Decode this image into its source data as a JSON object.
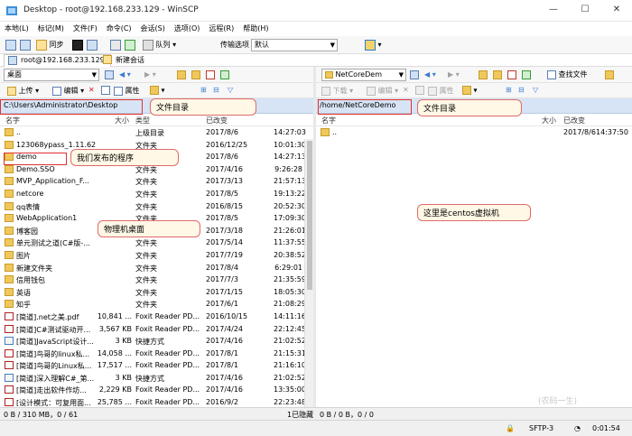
{
  "window": {
    "title": "Desktop - root@192.168.233.129 - WinSCP",
    "minimize": "—",
    "maximize": "☐",
    "close": "✕"
  },
  "menu": [
    "本地(L)",
    "标记(M)",
    "文件(F)",
    "命令(C)",
    "会话(S)",
    "选项(O)",
    "远程(R)",
    "帮助(H)"
  ],
  "toolbar": {
    "sync": "同步",
    "queue": "队列",
    "transfer_label": "传输选项",
    "transfer_value": "默认"
  },
  "session": {
    "tab": "root@192.168.233.129",
    "new": "新建会话"
  },
  "left": {
    "location": "桌面",
    "upload": "上传",
    "edit": "编辑",
    "props": "属性",
    "path": "C:\\Users\\Administrator\\Desktop",
    "columns": {
      "name": "名字",
      "size": "大小",
      "type": "类型",
      "changed": "已改变"
    },
    "files": [
      {
        "name": "..",
        "size": "",
        "type": "上级目录",
        "date": "2017/8/6",
        "time": "14:27:03",
        "icon": "up"
      },
      {
        "name": "123068ypass_1.11.62",
        "size": "",
        "type": "文件夹",
        "date": "2016/12/25",
        "time": "10:01:30",
        "icon": "folder"
      },
      {
        "name": "demo",
        "size": "",
        "type": "文件夹",
        "date": "2017/8/6",
        "time": "14:27:13",
        "icon": "folder"
      },
      {
        "name": "Demo.SSO",
        "size": "",
        "type": "文件夹",
        "date": "2017/4/16",
        "time": "9:26:28",
        "icon": "folder"
      },
      {
        "name": "MVP_Application_F...",
        "size": "",
        "type": "文件夹",
        "date": "2017/3/13",
        "time": "21:57:13",
        "icon": "folder"
      },
      {
        "name": "netcore",
        "size": "",
        "type": "文件夹",
        "date": "2017/8/5",
        "time": "19:13:22",
        "icon": "folder"
      },
      {
        "name": "qq表情",
        "size": "",
        "type": "文件夹",
        "date": "2016/8/15",
        "time": "20:52:30",
        "icon": "folder"
      },
      {
        "name": "WebApplication1",
        "size": "",
        "type": "文件夹",
        "date": "2017/8/5",
        "time": "17:09:30",
        "icon": "folder"
      },
      {
        "name": "博客园",
        "size": "",
        "type": "文件夹",
        "date": "2017/3/18",
        "time": "21:26:01",
        "icon": "folder"
      },
      {
        "name": "单元测试之道(C#版-...",
        "size": "",
        "type": "文件夹",
        "date": "2017/5/14",
        "time": "11:37:55",
        "icon": "folder"
      },
      {
        "name": "图片",
        "size": "",
        "type": "文件夹",
        "date": "2017/7/19",
        "time": "20:38:52",
        "icon": "folder"
      },
      {
        "name": "新建文件夹",
        "size": "",
        "type": "文件夹",
        "date": "2017/8/4",
        "time": "6:29:01",
        "icon": "folder"
      },
      {
        "name": "信用钱包",
        "size": "",
        "type": "文件夹",
        "date": "2017/7/3",
        "time": "21:35:59",
        "icon": "folder"
      },
      {
        "name": "英语",
        "size": "",
        "type": "文件夹",
        "date": "2017/1/15",
        "time": "18:05:30",
        "icon": "folder"
      },
      {
        "name": "知乎",
        "size": "",
        "type": "文件夹",
        "date": "2017/6/1",
        "time": "21:08:29",
        "icon": "folder"
      },
      {
        "name": "[简道].net之美.pdf",
        "size": "10,841 ...",
        "type": "Foxit Reader PD...",
        "date": "2016/10/15",
        "time": "14:11:16",
        "icon": "pdf"
      },
      {
        "name": "[简道]C#测试驱动开...",
        "size": "3,567 KB",
        "type": "Foxit Reader PD...",
        "date": "2017/4/24",
        "time": "22:12:45",
        "icon": "pdf"
      },
      {
        "name": "[简道]JavaScript设计...",
        "size": "3 KB",
        "type": "快捷方式",
        "date": "2017/4/16",
        "time": "21:02:52",
        "icon": "lnk"
      },
      {
        "name": "[简道]鸟哥的linux私...",
        "size": "14,058 ...",
        "type": "Foxit Reader PD...",
        "date": "2017/8/1",
        "time": "21:15:31",
        "icon": "pdf"
      },
      {
        "name": "[简道]鸟哥的Linux私...",
        "size": "17,517 ...",
        "type": "Foxit Reader PD...",
        "date": "2017/8/1",
        "time": "21:16:10",
        "icon": "pdf"
      },
      {
        "name": "[简道]深入理解C#_第...",
        "size": "3 KB",
        "type": "快捷方式",
        "date": "2017/4/16",
        "time": "21:02:52",
        "icon": "lnk"
      },
      {
        "name": "[简道]走出软件作坊...",
        "size": "2,229 KB",
        "type": "Foxit Reader PD...",
        "date": "2017/4/16",
        "time": "13:35:00",
        "icon": "pdf"
      },
      {
        "name": "[设计模式：可复用面...",
        "size": "25,785 ...",
        "type": "Foxit Reader PD...",
        "date": "2016/9/2",
        "time": "22:23:48",
        "icon": "pdf"
      }
    ],
    "status_left": "0 B / 310 MB，0 / 61",
    "status_right": "1已隐藏"
  },
  "right": {
    "location": "NetCoreDem",
    "find": "查找文件",
    "download": "下载",
    "edit": "编辑",
    "props": "属性",
    "path": "/home/NetCoreDemo",
    "columns": {
      "name": "名字",
      "size": "大小",
      "changed": "已改变"
    },
    "files": [
      {
        "name": "..",
        "date": "2017/8/6",
        "time": "14:37:50",
        "icon": "up"
      }
    ],
    "status": "0 B / 0 B，0 / 0"
  },
  "bottom": {
    "protocol": "SFTP-3",
    "elapsed": "0:01:54"
  },
  "annotations": {
    "left_dir": "文件目录",
    "right_dir": "文件目录",
    "program": "我们发布的程序",
    "desktop": "物理机桌面",
    "centos": "这里是centos虚拟机"
  },
  "watermark": "(农码一生)"
}
